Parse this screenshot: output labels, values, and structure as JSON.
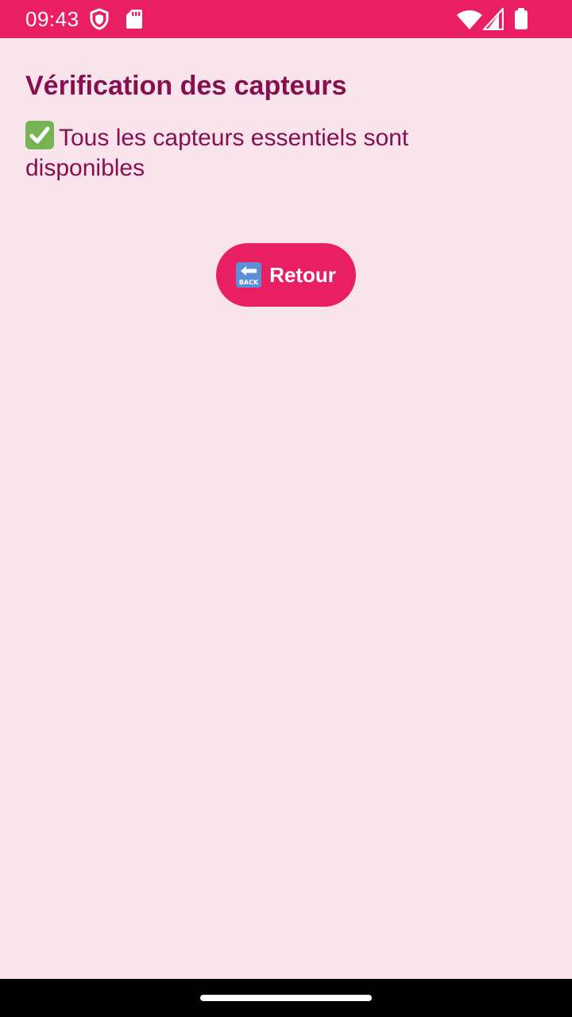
{
  "status_bar": {
    "time": "09:43",
    "icons": [
      "shield-icon",
      "sd-card-icon",
      "wifi-icon",
      "signal-icon",
      "battery-icon"
    ],
    "background": "#e91e63"
  },
  "screen": {
    "title": "Vérification des capteurs",
    "message_icon": "check-mark-icon",
    "message": "Tous les capteurs essentiels sont disponibles",
    "back_button": {
      "icon": "back-arrow-icon",
      "icon_text": "BACK",
      "label": "Retour"
    }
  },
  "colors": {
    "accent": "#e91e63",
    "text": "#880e4f",
    "background": "#fae4ec",
    "check": "#77b255"
  }
}
